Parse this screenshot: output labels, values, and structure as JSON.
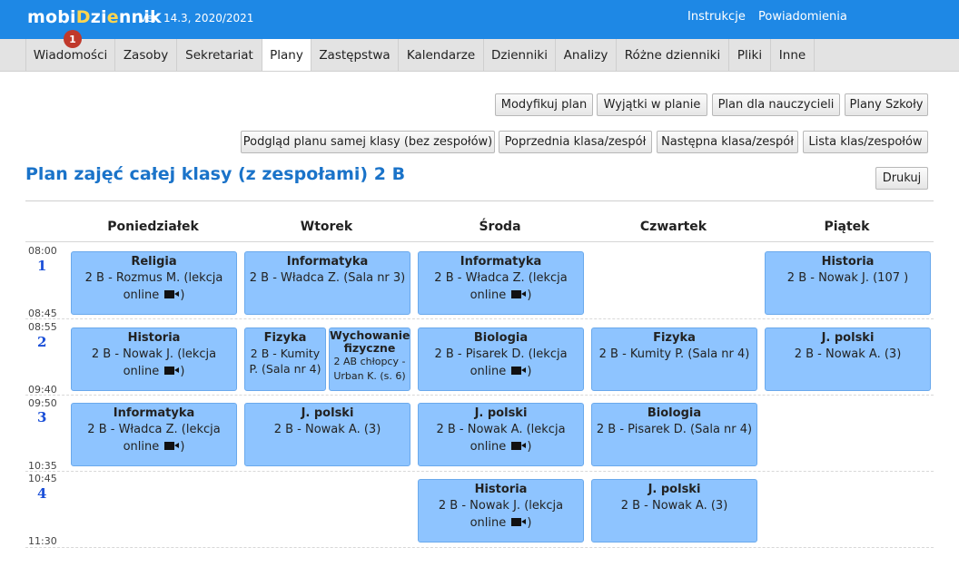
{
  "app": {
    "brand_prefix": "mobi",
    "brand_i": "D",
    "brand_mid": "zi",
    "brand_e": "e",
    "brand_suffix": "nnik",
    "version": "ver. 14.3, 2020/2021",
    "top_links": [
      "Instrukcje",
      "Powiadomienia"
    ],
    "notification_count": "1"
  },
  "nav": {
    "tabs": [
      "Wiadomości",
      "Zasoby",
      "Sekretariat",
      "Plany",
      "Zastępstwa",
      "Kalendarze",
      "Dzienniki",
      "Analizy",
      "Różne dzienniki",
      "Pliki",
      "Inne"
    ],
    "active_tab": "Plany"
  },
  "buttons": {
    "row1": [
      "Modyfikuj plan",
      "Wyjątki w planie",
      "Plan dla nauczycieli",
      "Plany Szkoły"
    ],
    "row2": [
      "Podgląd planu samej klasy (bez zespołów)",
      "Poprzednia klasa/zespół",
      "Następna klasa/zespół",
      "Lista klas/zespołów"
    ],
    "print": "Drukuj"
  },
  "page_title": "Plan zajęć całej klasy (z zespołami) 2 B",
  "days": [
    "Poniedziałek",
    "Wtorek",
    "Środa",
    "Czwartek",
    "Piątek"
  ],
  "periods": [
    {
      "num": "1",
      "start": "08:00",
      "end": "08:45"
    },
    {
      "num": "2",
      "start": "08:55",
      "end": "09:40"
    },
    {
      "num": "3",
      "start": "09:50",
      "end": "10:35"
    },
    {
      "num": "4",
      "start": "10:45",
      "end": "11:30"
    }
  ],
  "lessons": {
    "p1": {
      "mon": {
        "subject": "Religia",
        "desc": "2 B - Rozmus M. (lekcja online",
        "online": true
      },
      "tue": {
        "subject": "Informatyka",
        "desc": "2 B - Władca Z. (Sala nr 3)",
        "online": false
      },
      "wed": {
        "subject": "Informatyka",
        "desc": "2 B - Władca Z. (lekcja online",
        "online": true
      },
      "fri": {
        "subject": "Historia",
        "desc": "2 B - Nowak J. (107 )",
        "online": false
      }
    },
    "p2": {
      "mon": {
        "subject": "Historia",
        "desc": "2 B - Nowak J. (lekcja online",
        "online": true
      },
      "tue_a": {
        "subject": "Fizyka",
        "desc": "2 B - Kumity P. (Sala nr 4)",
        "online": false
      },
      "tue_b": {
        "subject": "Wychowanie fizyczne",
        "desc": "2 AB chłopcy - Urban K. (s. 6)",
        "online": false
      },
      "wed": {
        "subject": "Biologia",
        "desc": "2 B - Pisarek D. (lekcja online",
        "online": true
      },
      "thu": {
        "subject": "Fizyka",
        "desc": "2 B - Kumity P. (Sala nr 4)",
        "online": false
      },
      "fri": {
        "subject": "J. polski",
        "desc": "2 B - Nowak A. (3)",
        "online": false
      }
    },
    "p3": {
      "mon": {
        "subject": "Informatyka",
        "desc": "2 B - Władca Z. (lekcja online",
        "online": true
      },
      "tue": {
        "subject": "J. polski",
        "desc": "2 B - Nowak A. (3)",
        "online": false
      },
      "wed": {
        "subject": "J. polski",
        "desc": "2 B - Nowak A. (lekcja online",
        "online": true
      },
      "thu": {
        "subject": "Biologia",
        "desc": "2 B - Pisarek D. (Sala nr 4)",
        "online": false
      }
    },
    "p4": {
      "wed": {
        "subject": "Historia",
        "desc": "2 B - Nowak J. (lekcja online",
        "online": true
      },
      "thu": {
        "subject": "J. polski",
        "desc": "2 B - Nowak A. (3)",
        "online": false
      }
    }
  },
  "colors": {
    "topbar": "#1e88e5",
    "lesson_cell": "#8ec4ff",
    "title": "#1a73c9",
    "badge": "#c0392b"
  }
}
